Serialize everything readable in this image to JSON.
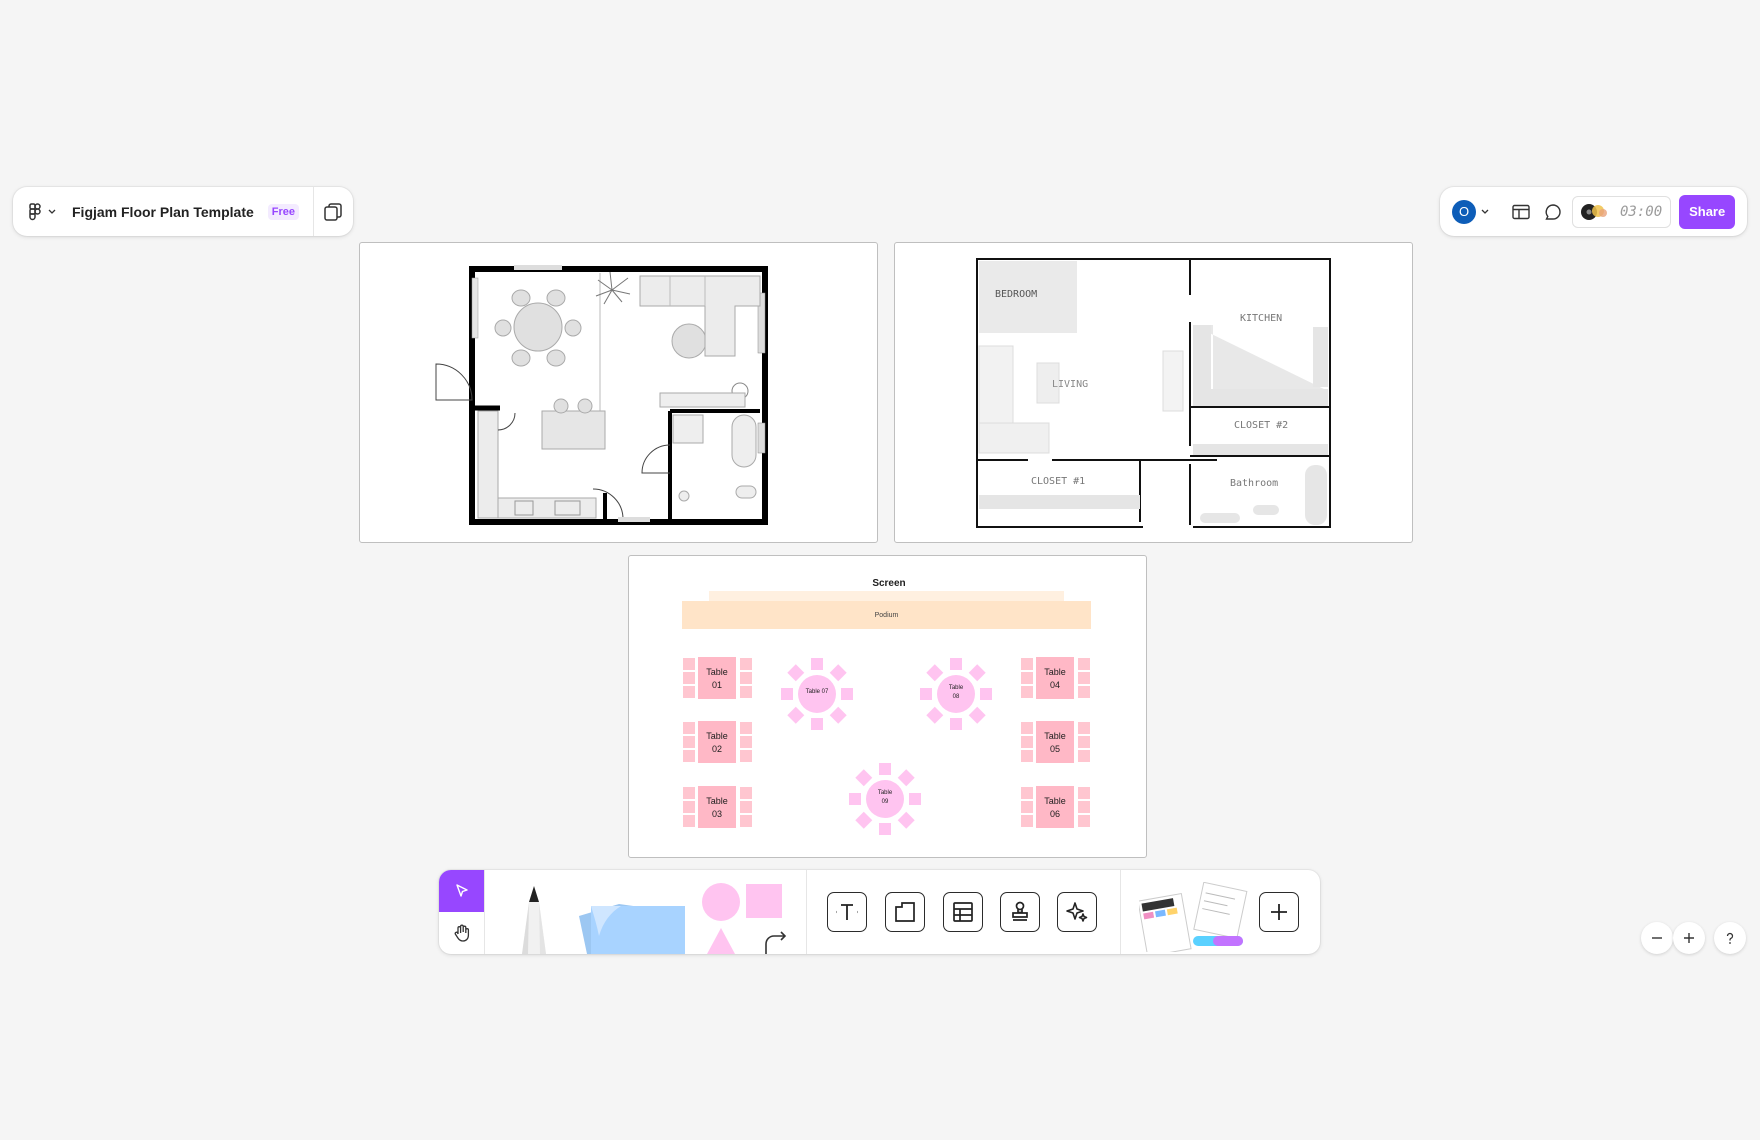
{
  "file": {
    "title": "Figjam Floor Plan Template",
    "badge": "Free"
  },
  "user": {
    "initial": "O"
  },
  "timer": {
    "value": "03:00"
  },
  "share": {
    "label": "Share"
  },
  "plan_b": {
    "rooms": {
      "bedroom": "BEDROOM",
      "living": "LIVING",
      "kitchen": "KITCHEN",
      "closet2": "CLOSET #2",
      "closet1": "CLOSET #1",
      "bathroom": "Bathroom"
    }
  },
  "seating": {
    "screen": "Screen",
    "podium": "Podium",
    "tables": {
      "t01a": "Table",
      "t01b": "01",
      "t02a": "Table",
      "t02b": "02",
      "t03a": "Table",
      "t03b": "03",
      "t04a": "Table",
      "t04b": "04",
      "t05a": "Table",
      "t05b": "05",
      "t06a": "Table",
      "t06b": "06",
      "t07": "Table 07",
      "t08a": "Table",
      "t08b": "08",
      "t09a": "Table",
      "t09b": "09"
    }
  },
  "colors": {
    "accent": "#9747ff",
    "avatar": "#0d5db8",
    "table_fill": "#ffc6d0",
    "round_table": "#ffc4f0",
    "podium": "#ffe4c8"
  },
  "icons": [
    "figma-menu-icon",
    "chevron-down-icon",
    "pages-icon",
    "layout-icon",
    "comment-icon",
    "music-icon",
    "select-arrow-icon",
    "hand-icon",
    "marker-icon",
    "sticky-note-icon",
    "shapes-icon",
    "connector-icon",
    "text-icon",
    "section-icon",
    "table-icon",
    "stamp-icon",
    "ai-sparkle-icon",
    "templates-icon",
    "plus-icon",
    "zoom-out-icon",
    "zoom-in-icon",
    "help-icon"
  ]
}
